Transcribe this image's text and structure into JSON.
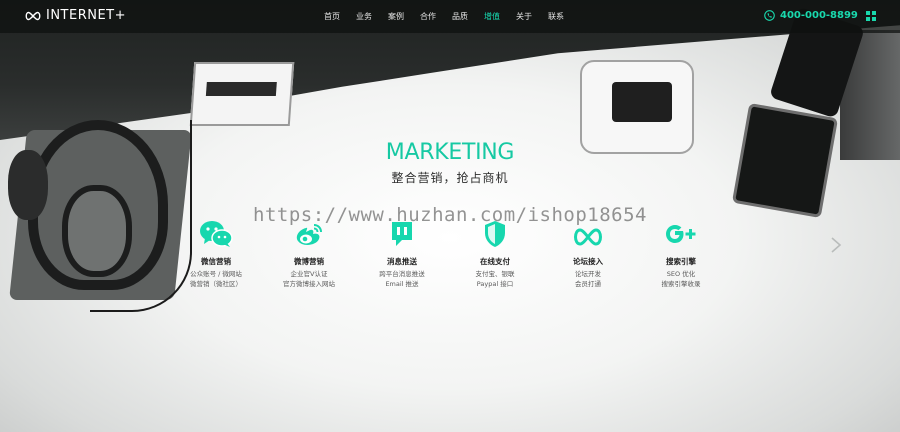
{
  "brand": {
    "logo_text": "INTERNET+"
  },
  "nav": {
    "items": [
      "首页",
      "业务",
      "案例",
      "合作",
      "品质",
      "增值",
      "关于",
      "联系"
    ],
    "active_index": 5
  },
  "contact": {
    "phone": "400-000-8899"
  },
  "hero": {
    "title": "MARKETING",
    "subtitle": "整合营销，抢占商机",
    "watermark": "https://www.huzhan.com/ishop18654"
  },
  "features": [
    {
      "icon": "wechat-icon",
      "name": "微信营销",
      "desc": "公众账号 / 微网站\n微营销（微社区）"
    },
    {
      "icon": "weibo-icon",
      "name": "微博营销",
      "desc": "企业官V认证\n官方微博接入网站"
    },
    {
      "icon": "message-icon",
      "name": "消息推送",
      "desc": "跨平台消息推送\nEmail 推送"
    },
    {
      "icon": "shield-icon",
      "name": "在线支付",
      "desc": "支付宝、银联\nPaypal 接口"
    },
    {
      "icon": "infinity-icon",
      "name": "论坛接入",
      "desc": "论坛开发\n会员打通"
    },
    {
      "icon": "google-plus-icon",
      "name": "搜索引擎",
      "desc": "SEO 优化\n搜索引擎收录"
    }
  ],
  "colors": {
    "accent": "#17d7ae",
    "navbar_bg": "rgba(14,16,15,0.72)"
  }
}
